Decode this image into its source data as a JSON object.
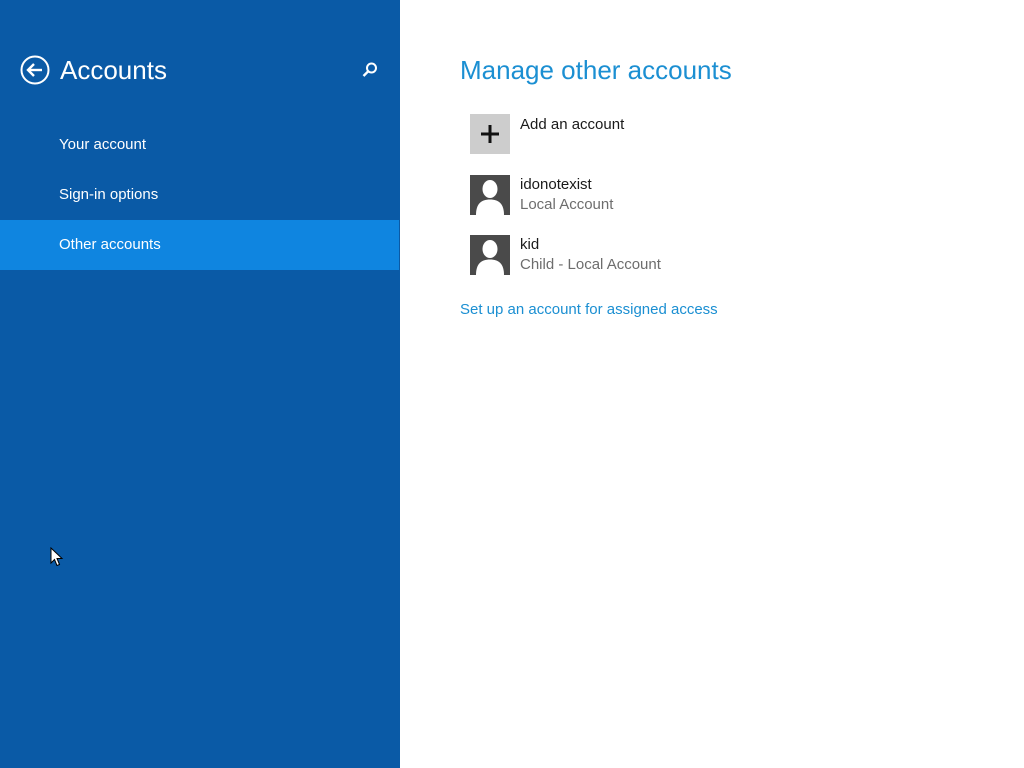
{
  "sidebar": {
    "title": "Accounts",
    "back_icon": "back-arrow-icon",
    "search_icon": "search-icon",
    "items": [
      {
        "label": "Your account",
        "selected": false
      },
      {
        "label": "Sign-in options",
        "selected": false
      },
      {
        "label": "Other accounts",
        "selected": true
      }
    ]
  },
  "main": {
    "title": "Manage other accounts",
    "add_account": {
      "label": "Add an account",
      "icon": "plus-icon"
    },
    "accounts": [
      {
        "name": "idonotexist",
        "type": "Local Account",
        "icon": "user-avatar-icon"
      },
      {
        "name": "kid",
        "type": "Child - Local Account",
        "icon": "user-avatar-icon"
      }
    ],
    "assigned_access_link": "Set up an account for assigned access"
  },
  "colors": {
    "sidebar_background": "#0a5aa6",
    "selected_item": "#0f85e0",
    "accent": "#1b8fd2",
    "content_background": "#ffffff"
  }
}
